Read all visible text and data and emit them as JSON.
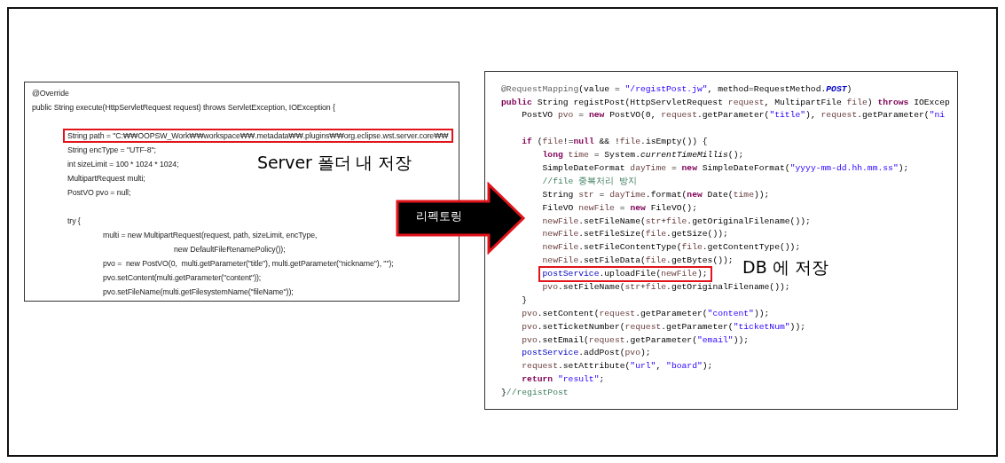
{
  "slide": {
    "left_code": {
      "lines": [
        {
          "text": "@Override",
          "highlighted": false,
          "blank_before": false
        },
        {
          "text": "public String execute(HttpServletRequest request) throws ServletException, IOException {",
          "highlighted": false,
          "blank_before": false
        },
        {
          "text": "\tString path = \"C:₩₩OOPSW_Work₩₩workspace₩₩.metadata₩₩.plugins₩₩org.eclipse.wst.server.core₩₩",
          "highlighted": true,
          "blank_before": true
        },
        {
          "text": "\tString encType = \"UTF-8\";",
          "highlighted": false,
          "blank_before": false
        },
        {
          "text": "\tint sizeLimit = 100 * 1024 * 1024;",
          "highlighted": false,
          "blank_before": false
        },
        {
          "text": "\tMultipartRequest multi;",
          "highlighted": false,
          "blank_before": false
        },
        {
          "text": "\tPostVO pvo = null;",
          "highlighted": false,
          "blank_before": false
        },
        {
          "text": "\ttry {",
          "highlighted": false,
          "blank_before": true
        },
        {
          "text": "\t\tmulti = new MultipartRequest(request, path, sizeLimit, encType,",
          "highlighted": false,
          "blank_before": false
        },
        {
          "text": "\t\t\t\tnew DefaultFileRenamePolicy());",
          "highlighted": false,
          "blank_before": false
        },
        {
          "text": "\t\tpvo =  new PostVO(0,  multi.getParameter(\"title\"), multi.getParameter(\"nickname\"), \"\");",
          "highlighted": false,
          "blank_before": false
        },
        {
          "text": "\t\tpvo.setContent(multi.getParameter(\"content\"));",
          "highlighted": false,
          "blank_before": false
        },
        {
          "text": "\t\tpvo.setFileName(multi.getFilesystemName(\"fileName\"));",
          "highlighted": false,
          "blank_before": false
        }
      ]
    },
    "left_caption": "Server 폴더 내 저장",
    "arrow_label": "리펙토링",
    "right_code": {
      "lines": [
        {
          "highlighted": false,
          "blank_before": false,
          "segments": [
            {
              "kind": "an",
              "text": "@RequestMapping"
            },
            {
              "kind": "p",
              "text": "(value = "
            },
            {
              "kind": "str",
              "text": "\"/registPost.jw\""
            },
            {
              "kind": "p",
              "text": ", method=RequestMethod."
            },
            {
              "kind": "const",
              "text": "POST"
            },
            {
              "kind": "p",
              "text": ")"
            }
          ]
        },
        {
          "highlighted": false,
          "blank_before": false,
          "segments": [
            {
              "kind": "kw",
              "text": "public"
            },
            {
              "kind": "p",
              "text": " String registPost(HttpServletRequest "
            },
            {
              "kind": "var",
              "text": "request"
            },
            {
              "kind": "p",
              "text": ", MultipartFile "
            },
            {
              "kind": "var",
              "text": "file"
            },
            {
              "kind": "p",
              "text": ") "
            },
            {
              "kind": "kw",
              "text": "throws"
            },
            {
              "kind": "p",
              "text": " IOExcep"
            }
          ]
        },
        {
          "highlighted": false,
          "blank_before": false,
          "segments": [
            {
              "kind": "p",
              "text": "    PostVO "
            },
            {
              "kind": "var",
              "text": "pvo"
            },
            {
              "kind": "p",
              "text": " = "
            },
            {
              "kind": "kw",
              "text": "new"
            },
            {
              "kind": "p",
              "text": " PostVO(0, "
            },
            {
              "kind": "var",
              "text": "request"
            },
            {
              "kind": "p",
              "text": ".getParameter("
            },
            {
              "kind": "str",
              "text": "\"title\""
            },
            {
              "kind": "p",
              "text": "), "
            },
            {
              "kind": "var",
              "text": "request"
            },
            {
              "kind": "p",
              "text": ".getParameter("
            },
            {
              "kind": "str",
              "text": "\"ni"
            }
          ]
        },
        {
          "highlighted": false,
          "blank_before": true,
          "segments": [
            {
              "kind": "kw",
              "text": "    if"
            },
            {
              "kind": "p",
              "text": " ("
            },
            {
              "kind": "var",
              "text": "file"
            },
            {
              "kind": "p",
              "text": "!="
            },
            {
              "kind": "kw",
              "text": "null"
            },
            {
              "kind": "p",
              "text": " && !"
            },
            {
              "kind": "var",
              "text": "file"
            },
            {
              "kind": "p",
              "text": ".isEmpty()) {"
            }
          ]
        },
        {
          "highlighted": false,
          "blank_before": false,
          "segments": [
            {
              "kind": "kw",
              "text": "        long"
            },
            {
              "kind": "var",
              "text": " time"
            },
            {
              "kind": "p",
              "text": " = System."
            },
            {
              "kind": "it",
              "text": "currentTimeMillis"
            },
            {
              "kind": "p",
              "text": "();"
            }
          ]
        },
        {
          "highlighted": false,
          "blank_before": false,
          "segments": [
            {
              "kind": "p",
              "text": "        SimpleDateFormat "
            },
            {
              "kind": "var",
              "text": "dayTime"
            },
            {
              "kind": "p",
              "text": " = "
            },
            {
              "kind": "kw",
              "text": "new"
            },
            {
              "kind": "p",
              "text": " SimpleDateFormat("
            },
            {
              "kind": "str",
              "text": "\"yyyy-mm-dd.hh.mm.ss\""
            },
            {
              "kind": "p",
              "text": ");"
            }
          ]
        },
        {
          "highlighted": false,
          "blank_before": false,
          "segments": [
            {
              "kind": "cm",
              "text": "        //file 중복처리 방지"
            }
          ]
        },
        {
          "highlighted": false,
          "blank_before": false,
          "segments": [
            {
              "kind": "p",
              "text": "        String "
            },
            {
              "kind": "var",
              "text": "str"
            },
            {
              "kind": "p",
              "text": " = "
            },
            {
              "kind": "var",
              "text": "dayTime"
            },
            {
              "kind": "p",
              "text": ".format("
            },
            {
              "kind": "kw",
              "text": "new"
            },
            {
              "kind": "p",
              "text": " Date("
            },
            {
              "kind": "var",
              "text": "time"
            },
            {
              "kind": "p",
              "text": "));"
            }
          ]
        },
        {
          "highlighted": false,
          "blank_before": false,
          "segments": [
            {
              "kind": "p",
              "text": "        FileVO "
            },
            {
              "kind": "var",
              "text": "newFile"
            },
            {
              "kind": "p",
              "text": " = "
            },
            {
              "kind": "kw",
              "text": "new"
            },
            {
              "kind": "p",
              "text": " FileVO();"
            }
          ]
        },
        {
          "highlighted": false,
          "blank_before": false,
          "segments": [
            {
              "kind": "var",
              "text": "        newFile"
            },
            {
              "kind": "p",
              "text": ".setFileName("
            },
            {
              "kind": "var",
              "text": "str"
            },
            {
              "kind": "p",
              "text": "+"
            },
            {
              "kind": "var",
              "text": "file"
            },
            {
              "kind": "p",
              "text": ".getOriginalFilename());"
            }
          ]
        },
        {
          "highlighted": false,
          "blank_before": false,
          "segments": [
            {
              "kind": "var",
              "text": "        newFile"
            },
            {
              "kind": "p",
              "text": ".setFileSize("
            },
            {
              "kind": "var",
              "text": "file"
            },
            {
              "kind": "p",
              "text": ".getSize());"
            }
          ]
        },
        {
          "highlighted": false,
          "blank_before": false,
          "segments": [
            {
              "kind": "var",
              "text": "        newFile"
            },
            {
              "kind": "p",
              "text": ".setFileContentType("
            },
            {
              "kind": "var",
              "text": "file"
            },
            {
              "kind": "p",
              "text": ".getContentType());"
            }
          ]
        },
        {
          "highlighted": false,
          "blank_before": false,
          "segments": [
            {
              "kind": "var",
              "text": "        newFile"
            },
            {
              "kind": "p",
              "text": ".setFileData("
            },
            {
              "kind": "var",
              "text": "file"
            },
            {
              "kind": "p",
              "text": ".getBytes());"
            }
          ]
        },
        {
          "highlighted": true,
          "blank_before": false,
          "segments": [
            {
              "kind": "fld",
              "text": "        postService"
            },
            {
              "kind": "p",
              "text": ".uploadFile("
            },
            {
              "kind": "var",
              "text": "newFile"
            },
            {
              "kind": "p",
              "text": ");"
            }
          ]
        },
        {
          "highlighted": false,
          "blank_before": false,
          "segments": [
            {
              "kind": "var",
              "text": "        pvo"
            },
            {
              "kind": "p",
              "text": ".setFileName("
            },
            {
              "kind": "var",
              "text": "str"
            },
            {
              "kind": "p",
              "text": "+"
            },
            {
              "kind": "var",
              "text": "file"
            },
            {
              "kind": "p",
              "text": ".getOriginalFilename());"
            }
          ]
        },
        {
          "highlighted": false,
          "blank_before": false,
          "segments": [
            {
              "kind": "p",
              "text": "    }"
            }
          ]
        },
        {
          "highlighted": false,
          "blank_before": false,
          "segments": [
            {
              "kind": "var",
              "text": "    pvo"
            },
            {
              "kind": "p",
              "text": ".setContent("
            },
            {
              "kind": "var",
              "text": "request"
            },
            {
              "kind": "p",
              "text": ".getParameter("
            },
            {
              "kind": "str",
              "text": "\"content\""
            },
            {
              "kind": "p",
              "text": "));"
            }
          ]
        },
        {
          "highlighted": false,
          "blank_before": false,
          "segments": [
            {
              "kind": "var",
              "text": "    pvo"
            },
            {
              "kind": "p",
              "text": ".setTicketNumber("
            },
            {
              "kind": "var",
              "text": "request"
            },
            {
              "kind": "p",
              "text": ".getParameter("
            },
            {
              "kind": "str",
              "text": "\"ticketNum\""
            },
            {
              "kind": "p",
              "text": "));"
            }
          ]
        },
        {
          "highlighted": false,
          "blank_before": false,
          "segments": [
            {
              "kind": "var",
              "text": "    pvo"
            },
            {
              "kind": "p",
              "text": ".setEmail("
            },
            {
              "kind": "var",
              "text": "request"
            },
            {
              "kind": "p",
              "text": ".getParameter("
            },
            {
              "kind": "str",
              "text": "\"email\""
            },
            {
              "kind": "p",
              "text": "));"
            }
          ]
        },
        {
          "highlighted": false,
          "blank_before": false,
          "segments": [
            {
              "kind": "fld",
              "text": "    postService"
            },
            {
              "kind": "p",
              "text": ".addPost("
            },
            {
              "kind": "var",
              "text": "pvo"
            },
            {
              "kind": "p",
              "text": ");"
            }
          ]
        },
        {
          "highlighted": false,
          "blank_before": false,
          "segments": [
            {
              "kind": "var",
              "text": "    request"
            },
            {
              "kind": "p",
              "text": ".setAttribute("
            },
            {
              "kind": "str",
              "text": "\"url\""
            },
            {
              "kind": "p",
              "text": ", "
            },
            {
              "kind": "str",
              "text": "\"board\""
            },
            {
              "kind": "p",
              "text": ");"
            }
          ]
        },
        {
          "highlighted": false,
          "blank_before": false,
          "segments": [
            {
              "kind": "kw",
              "text": "    return"
            },
            {
              "kind": "str",
              "text": " \"result\""
            },
            {
              "kind": "p",
              "text": ";"
            }
          ]
        },
        {
          "highlighted": false,
          "blank_before": false,
          "segments": [
            {
              "kind": "p",
              "text": "}"
            },
            {
              "kind": "cm",
              "text": "//registPost"
            }
          ]
        }
      ]
    },
    "right_caption": "DB 에 저장"
  }
}
